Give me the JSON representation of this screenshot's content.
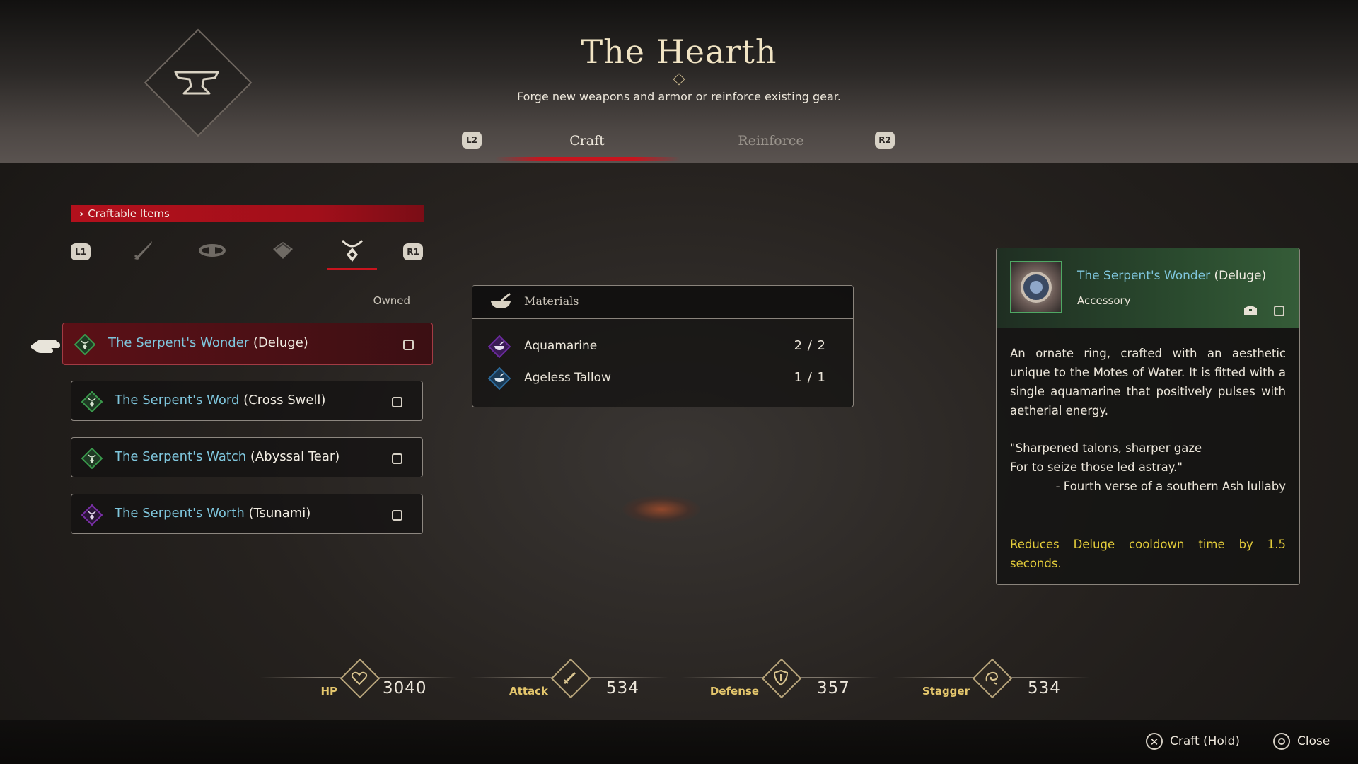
{
  "header": {
    "title": "The Hearth",
    "subtitle": "Forge new weapons and armor or reinforce existing gear.",
    "left_shoulder": "L2",
    "right_shoulder": "R2",
    "tabs": [
      {
        "label": "Craft",
        "active": true
      },
      {
        "label": "Reinforce",
        "active": false
      }
    ]
  },
  "craftable": {
    "section_label": "Craftable Items",
    "left_shoulder": "L1",
    "right_shoulder": "R1",
    "categories": [
      {
        "icon": "sword-icon",
        "active": false
      },
      {
        "icon": "belt-icon",
        "active": false
      },
      {
        "icon": "armlet-icon",
        "active": false
      },
      {
        "icon": "accessory-icon",
        "active": true
      }
    ],
    "owned_label": "Owned",
    "items": [
      {
        "name": "The Serpent's Wonder",
        "variant": "(Deluge)",
        "gem_color": "#3a9a4c",
        "selected": true
      },
      {
        "name": "The Serpent's Word",
        "variant": "(Cross Swell)",
        "gem_color": "#3a9a4c",
        "selected": false
      },
      {
        "name": "The Serpent's Watch",
        "variant": "(Abyssal Tear)",
        "gem_color": "#3a9a4c",
        "selected": false
      },
      {
        "name": "The Serpent's Worth",
        "variant": "(Tsunami)",
        "gem_color": "#7a2fa8",
        "selected": false
      }
    ]
  },
  "materials": {
    "title": "Materials",
    "rows": [
      {
        "name": "Aquamarine",
        "count": "2 / 2",
        "gem_color": "#6a2a9c"
      },
      {
        "name": "Ageless Tallow",
        "count": "1 / 1",
        "gem_color": "#2d6a9a"
      }
    ]
  },
  "detail": {
    "name": "The Serpent's Wonder",
    "variant": "(Deluge)",
    "type": "Accessory",
    "description": "An ornate ring, crafted with an aesthetic unique to the Motes of Water. It is fitted with a single aquamarine that positively pulses with aetherial energy.",
    "quote_line1": "\"Sharpened talons, sharper gaze",
    "quote_line2": "For to seize those led astray.\"",
    "quote_attribution": "- Fourth verse of a southern Ash lullaby",
    "effect": "Reduces Deluge cooldown time by 1.5 seconds."
  },
  "stats": [
    {
      "label": "HP",
      "value": "3040",
      "icon": "heart-icon"
    },
    {
      "label": "Attack",
      "value": "534",
      "icon": "sword-icon"
    },
    {
      "label": "Defense",
      "value": "357",
      "icon": "shield-icon"
    },
    {
      "label": "Stagger",
      "value": "534",
      "icon": "stagger-icon"
    }
  ],
  "prompts": {
    "craft": "Craft (Hold)",
    "close": "Close"
  },
  "colors": {
    "accent_red": "#c8141e",
    "name_blue": "#7fc6dd",
    "effect_yellow": "#e3cc3a",
    "stat_gold": "#e4c66c"
  }
}
